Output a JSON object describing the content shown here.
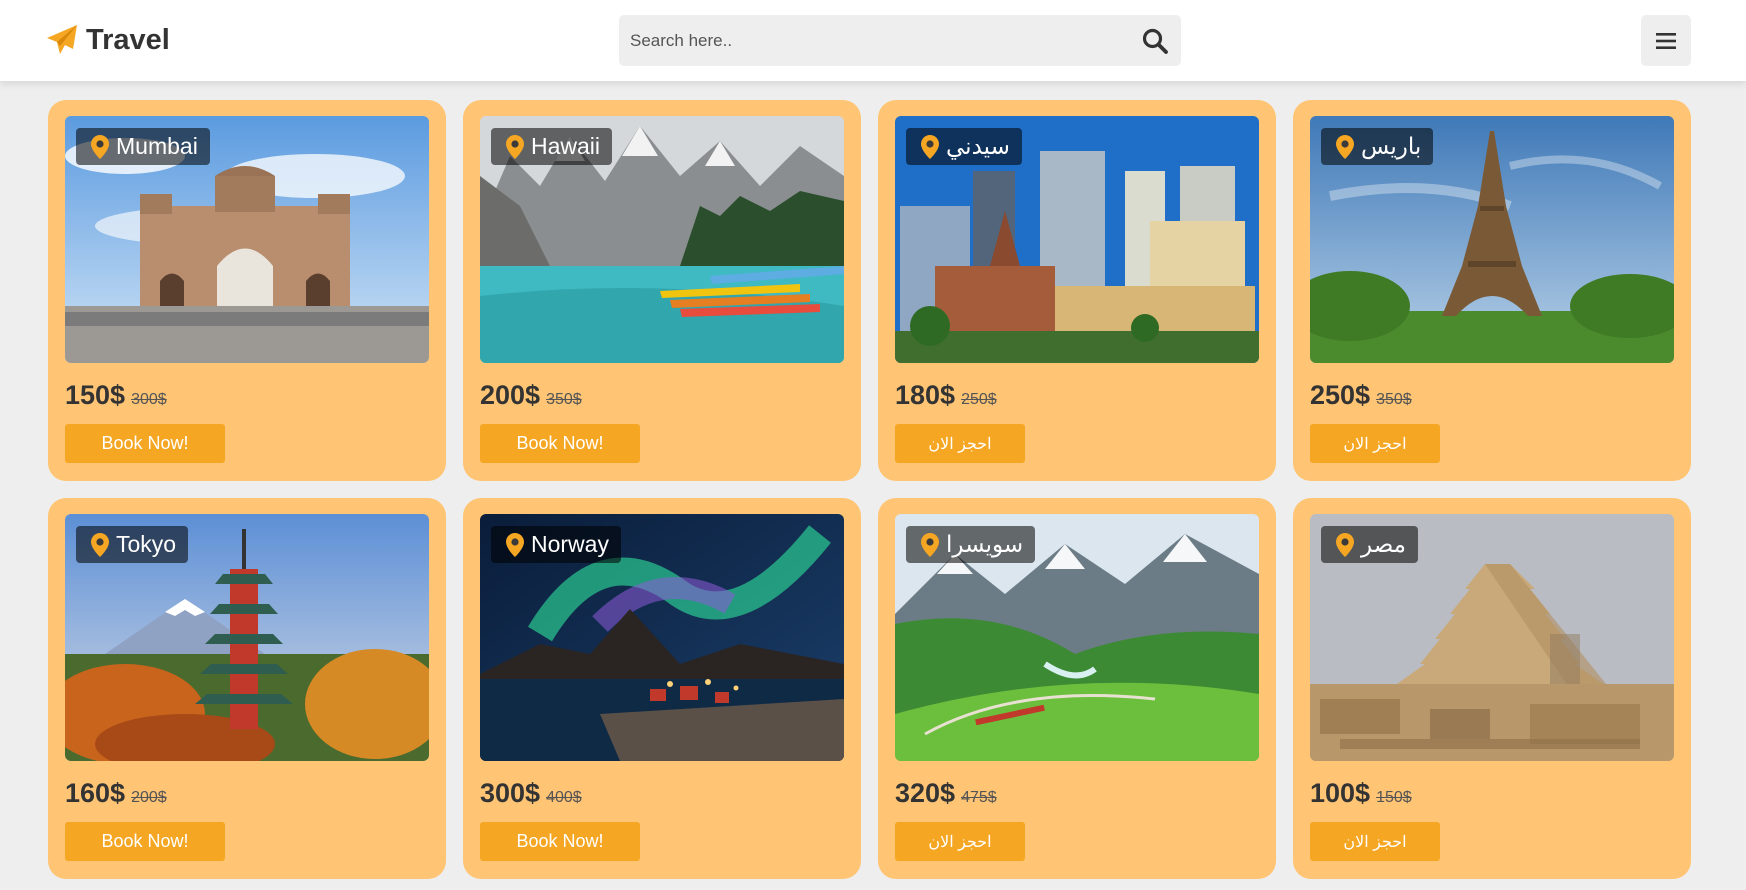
{
  "header": {
    "logo_text": "Travel",
    "logo_icon": "paper-plane-icon",
    "search_placeholder": "Search here..",
    "search_icon": "search-icon",
    "menu_icon": "bars-icon"
  },
  "colors": {
    "accent": "#f5a623",
    "card_background": "#ffc574",
    "page_background": "#eeeeee",
    "text_dark": "#333333"
  },
  "cards": [
    {
      "place": "Mumbai",
      "price": "150$",
      "old_price": "300$",
      "button": "Book Now!",
      "image": "gateway-of-india-photo"
    },
    {
      "place": "Hawaii",
      "price": "200$",
      "old_price": "350$",
      "button": "Book Now!",
      "image": "mountain-lake-canoes-photo"
    },
    {
      "place": "سيدني",
      "price": "180$",
      "old_price": "250$",
      "button": "احجز الان",
      "image": "sydney-city-buildings-photo"
    },
    {
      "place": "باريس",
      "price": "250$",
      "old_price": "350$",
      "button": "احجز الان",
      "image": "eiffel-tower-photo"
    },
    {
      "place": "Tokyo",
      "price": "160$",
      "old_price": "200$",
      "button": "Book Now!",
      "image": "pagoda-mount-fuji-photo"
    },
    {
      "place": "Norway",
      "price": "300$",
      "old_price": "400$",
      "button": "Book Now!",
      "image": "northern-lights-village-photo"
    },
    {
      "place": "سويسرا",
      "price": "320$",
      "old_price": "475$",
      "button": "احجز الان",
      "image": "swiss-alps-train-photo"
    },
    {
      "place": "مصر",
      "price": "100$",
      "old_price": "150$",
      "button": "احجز الان",
      "image": "step-pyramid-photo"
    }
  ]
}
